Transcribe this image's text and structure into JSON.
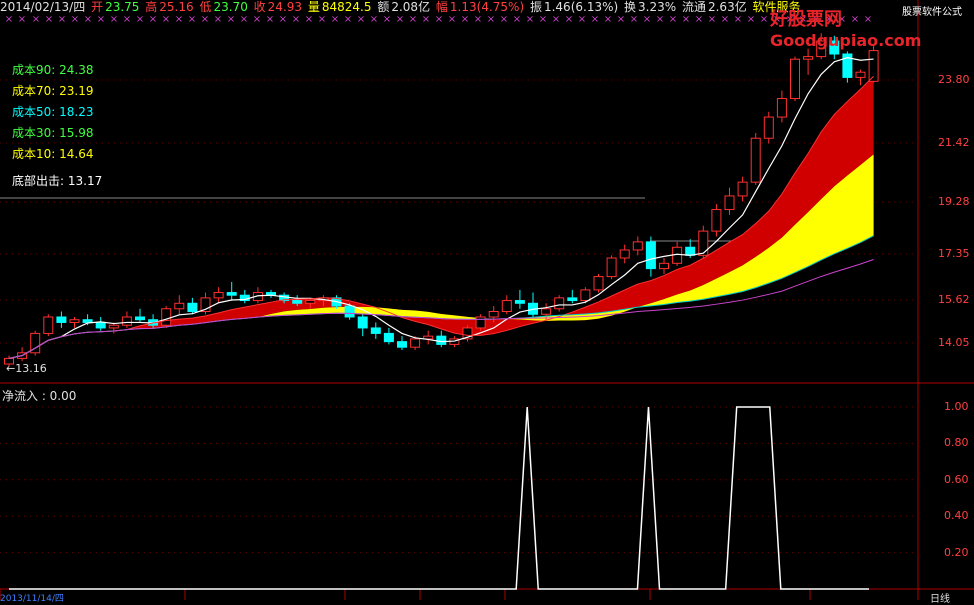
{
  "header": {
    "date": "2014/02/13/四",
    "open_label": "开",
    "open": "23.75",
    "high_label": "高",
    "high": "25.16",
    "low_label": "低",
    "low": "23.70",
    "close_label": "收",
    "close": "24.93",
    "volume_label": "量",
    "volume": "84824.5",
    "amount_label": "额",
    "amount": "2.08亿",
    "change_label": "幅",
    "change": "1.13(4.75%)",
    "amplitude_label": "振",
    "amplitude": "1.46(6.13%)",
    "turnover_label": "换",
    "turnover": "3.23%",
    "float_label": "流通",
    "float": "2.63亿",
    "service": "软件服务"
  },
  "brand": {
    "name_cn": "好股票网",
    "domain": "Goodgupiao.com",
    "tagline": "股票软件公式"
  },
  "cost_legend": [
    {
      "label": "成本90:",
      "value": "24.38",
      "color": "#40ff40"
    },
    {
      "label": "成本70:",
      "value": "23.19",
      "color": "#ffff00"
    },
    {
      "label": "成本50:",
      "value": "18.23",
      "color": "#00ffff"
    },
    {
      "label": "成本30:",
      "value": "15.98",
      "color": "#40ff40"
    },
    {
      "label": "成本10:",
      "value": "14.64",
      "color": "#ffff00"
    },
    {
      "label": "底部出击:",
      "value": "13.17",
      "color": "#ffffff"
    }
  ],
  "low_marker": "←13.16",
  "flow_label": "净流入 : 0.00",
  "date_bottom": "2013/11/14/四",
  "footer_right": "日线",
  "chart_data": [
    {
      "type": "candlestick",
      "y_ticks": [
        "23.80",
        "21.42",
        "19.28",
        "17.35",
        "15.62",
        "14.05"
      ],
      "y_tick_values": [
        23.8,
        21.42,
        19.28,
        17.35,
        15.62,
        14.05
      ],
      "low": 13.16,
      "candles": [
        [
          13.3,
          13.6,
          13.2,
          13.5
        ],
        [
          13.5,
          13.9,
          13.4,
          13.7
        ],
        [
          13.7,
          14.5,
          13.6,
          14.4
        ],
        [
          14.4,
          15.1,
          14.3,
          15.0
        ],
        [
          15.0,
          15.2,
          14.6,
          14.8
        ],
        [
          14.8,
          15.0,
          14.6,
          14.9
        ],
        [
          14.9,
          15.1,
          14.7,
          14.8
        ],
        [
          14.8,
          15.0,
          14.5,
          14.6
        ],
        [
          14.6,
          14.8,
          14.4,
          14.7
        ],
        [
          14.7,
          15.2,
          14.6,
          15.0
        ],
        [
          15.0,
          15.3,
          14.8,
          14.9
        ],
        [
          14.9,
          15.1,
          14.6,
          14.7
        ],
        [
          14.7,
          15.4,
          14.6,
          15.3
        ],
        [
          15.3,
          15.8,
          15.1,
          15.5
        ],
        [
          15.5,
          15.7,
          15.1,
          15.2
        ],
        [
          15.2,
          15.9,
          15.1,
          15.7
        ],
        [
          15.7,
          16.1,
          15.5,
          15.9
        ],
        [
          15.9,
          16.3,
          15.6,
          15.8
        ],
        [
          15.8,
          16.0,
          15.5,
          15.6
        ],
        [
          15.6,
          16.1,
          15.5,
          15.9
        ],
        [
          15.9,
          16.0,
          15.7,
          15.8
        ],
        [
          15.8,
          15.9,
          15.5,
          15.6
        ],
        [
          15.6,
          15.8,
          15.4,
          15.5
        ],
        [
          15.5,
          15.7,
          15.3,
          15.6
        ],
        [
          15.6,
          15.8,
          15.4,
          15.7
        ],
        [
          15.7,
          15.8,
          15.3,
          15.4
        ],
        [
          15.4,
          15.5,
          14.9,
          15.0
        ],
        [
          15.0,
          15.1,
          14.3,
          14.6
        ],
        [
          14.6,
          14.8,
          14.2,
          14.4
        ],
        [
          14.4,
          14.6,
          14.0,
          14.1
        ],
        [
          14.1,
          14.3,
          13.8,
          13.9
        ],
        [
          13.9,
          14.3,
          13.8,
          14.2
        ],
        [
          14.2,
          14.5,
          14.0,
          14.3
        ],
        [
          14.3,
          14.5,
          13.9,
          14.0
        ],
        [
          14.0,
          14.3,
          13.9,
          14.2
        ],
        [
          14.2,
          14.7,
          14.1,
          14.6
        ],
        [
          14.6,
          15.1,
          14.5,
          15.0
        ],
        [
          15.0,
          15.4,
          14.8,
          15.2
        ],
        [
          15.2,
          15.8,
          15.1,
          15.6
        ],
        [
          15.6,
          16.0,
          15.3,
          15.5
        ],
        [
          15.5,
          15.9,
          15.0,
          15.1
        ],
        [
          15.1,
          15.5,
          14.9,
          15.3
        ],
        [
          15.3,
          15.8,
          15.2,
          15.7
        ],
        [
          15.7,
          16.0,
          15.5,
          15.6
        ],
        [
          15.6,
          16.1,
          15.5,
          16.0
        ],
        [
          16.0,
          16.6,
          15.9,
          16.5
        ],
        [
          16.5,
          17.3,
          16.4,
          17.2
        ],
        [
          17.2,
          17.7,
          17.0,
          17.5
        ],
        [
          17.5,
          18.0,
          17.3,
          17.8
        ],
        [
          17.8,
          18.0,
          16.5,
          16.8
        ],
        [
          16.8,
          17.2,
          16.6,
          17.0
        ],
        [
          17.0,
          17.8,
          16.9,
          17.6
        ],
        [
          17.6,
          17.9,
          17.2,
          17.3
        ],
        [
          17.3,
          18.4,
          17.2,
          18.2
        ],
        [
          18.2,
          19.2,
          18.0,
          19.0
        ],
        [
          19.0,
          19.8,
          18.8,
          19.5
        ],
        [
          19.5,
          20.2,
          19.3,
          20.0
        ],
        [
          20.0,
          21.8,
          19.9,
          21.6
        ],
        [
          21.6,
          22.6,
          21.4,
          22.4
        ],
        [
          22.4,
          23.4,
          22.2,
          23.1
        ],
        [
          23.1,
          24.7,
          23.0,
          24.6
        ],
        [
          24.6,
          25.0,
          24.0,
          24.7
        ],
        [
          24.7,
          25.6,
          24.6,
          25.3
        ],
        [
          25.3,
          25.5,
          24.6,
          24.8
        ],
        [
          24.8,
          24.9,
          23.7,
          23.9
        ],
        [
          23.9,
          24.2,
          23.6,
          24.1
        ],
        [
          23.75,
          25.16,
          23.7,
          24.93
        ]
      ]
    },
    {
      "type": "line",
      "name": "净流入",
      "y_ticks": [
        "1.00",
        "0.80",
        "0.60",
        "0.40",
        "0.20"
      ],
      "y_tick_values": [
        1.0,
        0.8,
        0.6,
        0.4,
        0.2
      ],
      "ylim": [
        0,
        1
      ],
      "values": [
        0,
        0,
        0,
        0,
        0,
        0,
        0,
        0,
        0,
        0,
        0,
        0,
        0,
        0,
        0,
        0,
        0,
        0,
        0,
        0,
        0,
        0,
        0,
        0,
        0,
        0,
        0,
        0,
        0,
        0,
        0,
        0,
        0,
        0,
        0,
        0,
        0,
        0,
        0,
        0,
        0,
        0,
        0,
        0,
        0,
        0,
        0,
        1,
        0,
        0,
        0,
        0,
        0,
        0,
        0,
        0,
        0,
        0,
        1,
        0,
        0,
        0,
        0,
        0,
        0,
        0,
        1,
        1,
        1,
        1,
        0,
        0,
        0,
        0,
        0,
        0,
        0,
        0,
        0
      ]
    }
  ]
}
